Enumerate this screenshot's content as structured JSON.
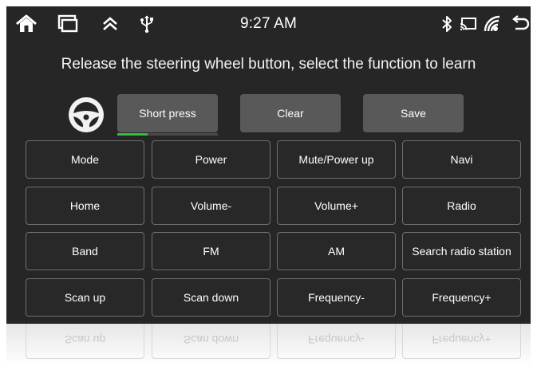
{
  "status_bar": {
    "time": "9:27 AM",
    "left_icons": [
      "home-icon",
      "recent-apps-icon",
      "chevron-up-icon",
      "usb-icon"
    ],
    "right_icons": [
      "bluetooth-icon",
      "cast-icon",
      "signal-icon",
      "back-icon"
    ]
  },
  "instruction": "Release the steering wheel button, select the function to learn",
  "controls": {
    "short_press_label": "Short press",
    "clear_label": "Clear",
    "save_label": "Save",
    "press_progress": 0.3
  },
  "functions": [
    [
      "Mode",
      "Power",
      "Mute/Power up",
      "Navi"
    ],
    [
      "Home",
      "Volume-",
      "Volume+",
      "Radio"
    ],
    [
      "Band",
      "FM",
      "AM",
      "Search radio station"
    ],
    [
      "Scan up",
      "Scan down",
      "Frequency-",
      "Frequency+"
    ]
  ],
  "colors": {
    "background": "#262626",
    "button_fill": "#595959",
    "button_border": "#6e6e6e",
    "progress": "#2fbf3a"
  }
}
